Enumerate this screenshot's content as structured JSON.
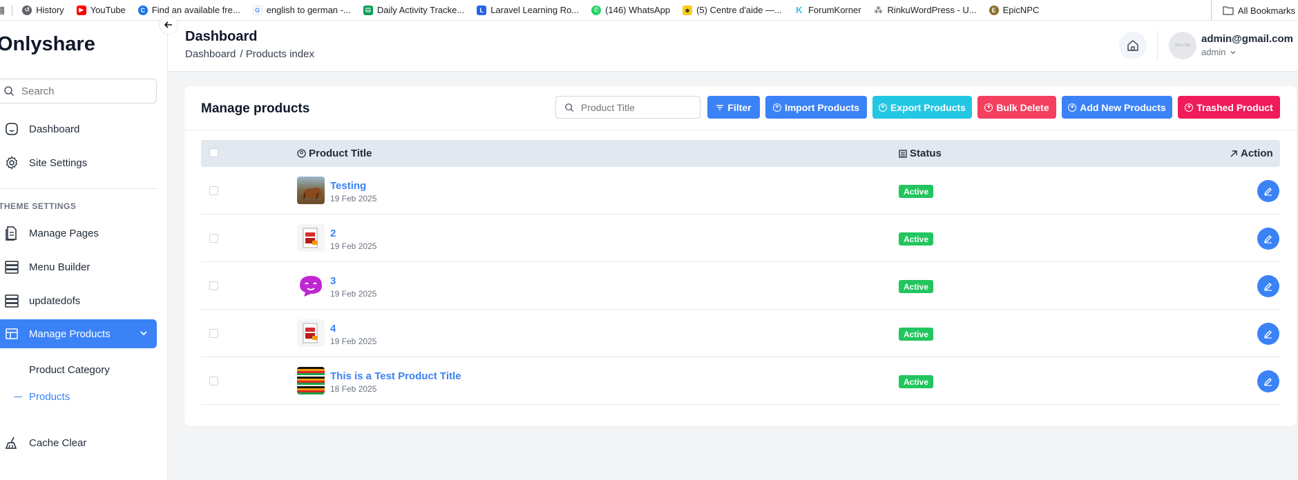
{
  "bookmarks": {
    "items": [
      {
        "label": "History",
        "color": "#5f6368"
      },
      {
        "label": "YouTube",
        "color": "#ff0000"
      },
      {
        "label": "Find an available fre...",
        "color": "#1a73e8"
      },
      {
        "label": "english to german -...",
        "color": "#4285f4"
      },
      {
        "label": "Daily Activity Tracke...",
        "color": "#0f9d58"
      },
      {
        "label": "Laravel Learning Ro...",
        "color": "#2563eb"
      },
      {
        "label": "(146) WhatsApp",
        "color": "#25d366"
      },
      {
        "label": "(5) Centre d'aide —...",
        "color": "#facc15"
      },
      {
        "label": "ForumKorner",
        "color": "#38bdf8"
      },
      {
        "label": "RinkuWordPress - U...",
        "color": "#6b7280"
      },
      {
        "label": "EpicNPC",
        "color": "#8b6f2a"
      }
    ],
    "all_label": "All Bookmarks"
  },
  "sidebar": {
    "brand": "Onlyshare",
    "search_placeholder": "Search",
    "items": [
      {
        "label": "Dashboard"
      },
      {
        "label": "Site Settings"
      }
    ],
    "section_title": "THEME SETTINGS",
    "theme_items": [
      {
        "label": "Manage Pages"
      },
      {
        "label": "Menu Builder"
      },
      {
        "label": "updatedofs"
      },
      {
        "label": "Manage Products"
      }
    ],
    "sub_items": [
      {
        "label": "Product Category"
      },
      {
        "label": "Products"
      }
    ],
    "cache_label": "Cache Clear"
  },
  "header": {
    "title": "Dashboard",
    "breadcrumb_home": "Dashboard",
    "breadcrumb_current": "/ Products index",
    "avatar_text": "100 x 100",
    "user_email": "admin@gmail.com",
    "user_role": "admin"
  },
  "card": {
    "title": "Manage products",
    "search_placeholder": "Product Title",
    "buttons": {
      "filter": "Filter",
      "import": "Import Products",
      "export": "Export Products",
      "bulk_delete": "Bulk Delete",
      "add_new": "Add New Products",
      "trashed": "Trashed Product"
    },
    "colors": {
      "blue": "#3b82f6",
      "cyan": "#22c7e4",
      "pink": "#f43f5e",
      "crimson": "#f01b5a",
      "green": "#22c55e"
    }
  },
  "table": {
    "headers": {
      "title": "Product Title",
      "status": "Status",
      "action": "Action"
    },
    "rows": [
      {
        "title": "Testing",
        "date": "19 Feb 2025",
        "status": "Active"
      },
      {
        "title": "2",
        "date": "19 Feb 2025",
        "status": "Active"
      },
      {
        "title": "3",
        "date": "19 Feb 2025",
        "status": "Active"
      },
      {
        "title": "4",
        "date": "19 Feb 2025",
        "status": "Active"
      },
      {
        "title": "This is a Test Product Title",
        "date": "18 Feb 2025",
        "status": "Active"
      }
    ]
  }
}
